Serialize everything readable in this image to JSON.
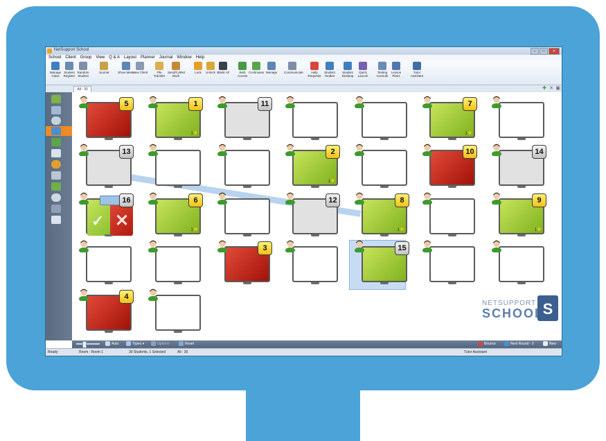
{
  "window": {
    "title": "NetSupport School",
    "buttons": [
      "–",
      "□",
      "✕"
    ]
  },
  "menu": [
    "School",
    "Client",
    "Group",
    "View",
    "Q & A",
    "Layout",
    "Planner",
    "Journal",
    "Window",
    "Help"
  ],
  "ribbon": [
    {
      "label": "Manage Class",
      "icon": "manage-class-icon",
      "color": "#3f7fc0"
    },
    {
      "label": "Student Register",
      "icon": "student-register-icon",
      "color": "#6a8cb3"
    },
    {
      "label": "Random Student",
      "icon": "random-student-icon",
      "color": "#7f8fa6"
    },
    {
      "label": "Journal",
      "icon": "journal-icon",
      "color": "#c9a14a"
    },
    {
      "label": "Show Menu",
      "icon": "show-icon",
      "color": "#5d87b6"
    },
    {
      "label": "View Client",
      "icon": "view-client-icon",
      "color": "#8a9ab0"
    },
    {
      "label": "File Transfer",
      "icon": "file-transfer-icon",
      "color": "#d8b050"
    },
    {
      "label": "Send/Collect Work",
      "icon": "send-collect-icon",
      "color": "#c48a3a"
    },
    {
      "label": "Lock",
      "icon": "lock-icon",
      "color": "#e2a02b"
    },
    {
      "label": "Unlock",
      "icon": "unlock-icon",
      "color": "#d9a838"
    },
    {
      "label": "Blank All",
      "icon": "blank-all-icon",
      "color": "#3a3f4a"
    },
    {
      "label": "Web Access",
      "icon": "web-access-icon",
      "color": "#4a9a48"
    },
    {
      "label": "Co-Browse",
      "icon": "co-browse-icon",
      "color": "#5aa54a"
    },
    {
      "label": "Manage",
      "icon": "manage-icon",
      "color": "#5f86b5"
    },
    {
      "label": "Communicate",
      "icon": "communicate-icon",
      "color": "#7e8ea4"
    },
    {
      "label": "Help Requests",
      "icon": "help-requests-icon",
      "color": "#d8463a"
    },
    {
      "label": "Student Toolbar",
      "icon": "student-toolbar-icon",
      "color": "#3f7fc0"
    },
    {
      "label": "Student Desktop",
      "icon": "student-desktop-icon",
      "color": "#3f7fc0"
    },
    {
      "label": "Quick Launch",
      "icon": "quick-launch-icon",
      "color": "#7a5fb0"
    },
    {
      "label": "Testing Console",
      "icon": "testing-console-icon",
      "color": "#6c8cb8"
    },
    {
      "label": "Lesson Plans",
      "icon": "lesson-plans-icon",
      "color": "#5476b0"
    },
    {
      "label": "Tutor Assistant",
      "icon": "tutor-assistant-icon",
      "color": "#3f6fa8"
    }
  ],
  "tab": {
    "label": "All : 30"
  },
  "tiles": [
    {
      "state": "red",
      "badge": "5",
      "badge_style": "yellow"
    },
    {
      "state": "green",
      "badge": "1",
      "badge_style": "yellow",
      "stars": "1"
    },
    {
      "state": "grey",
      "badge": "11",
      "badge_style": "grey"
    },
    {
      "state": "white"
    },
    {
      "state": "white"
    },
    {
      "state": "green",
      "badge": "7",
      "badge_style": "yellow",
      "stars": "1"
    },
    {
      "state": "white"
    },
    {
      "state": "grey",
      "badge": "13",
      "badge_style": "grey"
    },
    {
      "state": "white"
    },
    {
      "state": "white"
    },
    {
      "state": "green",
      "badge": "2",
      "badge_style": "yellow",
      "stars": "1"
    },
    {
      "state": "white"
    },
    {
      "state": "red",
      "badge": "10",
      "badge_style": "yellow"
    },
    {
      "state": "grey",
      "badge": "14",
      "badge_style": "grey"
    },
    {
      "state": "split",
      "badge": "16",
      "badge_style": "grey"
    },
    {
      "state": "green",
      "badge": "6",
      "badge_style": "yellow",
      "stars": "1"
    },
    {
      "state": "white"
    },
    {
      "state": "grey",
      "badge": "12",
      "badge_style": "grey"
    },
    {
      "state": "green",
      "badge": "8",
      "badge_style": "yellow",
      "stars": "1"
    },
    {
      "state": "white"
    },
    {
      "state": "green",
      "badge": "9",
      "badge_style": "yellow",
      "stars": "1"
    },
    {
      "state": "white"
    },
    {
      "state": "white"
    },
    {
      "state": "red",
      "badge": "3",
      "badge_style": "yellow"
    },
    {
      "state": "white"
    },
    {
      "state": "green",
      "badge": "15",
      "badge_style": "grey",
      "selected": true
    },
    {
      "state": "white"
    },
    {
      "state": "white"
    },
    {
      "state": "red",
      "badge": "4",
      "badge_style": "yellow"
    },
    {
      "state": "white"
    }
  ],
  "logo": {
    "line1": "NETSUPPORT",
    "line2": "SCHOOL",
    "mark": "S"
  },
  "bottombar": {
    "auto": "Auto",
    "types": "Types ▾",
    "options": "Options",
    "reset": "Reset",
    "bounce": "Bounce",
    "next_round": "Next Round - 2",
    "new": "New"
  },
  "status": {
    "ready": "Ready",
    "room": "Room : Room 1",
    "students": "30 Students, 1 Selected",
    "all": "All : 30",
    "tutor": "Tutor Assistant"
  }
}
